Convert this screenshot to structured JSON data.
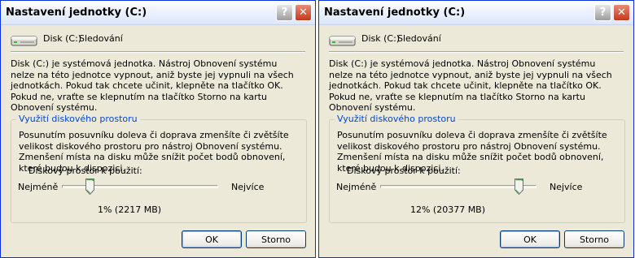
{
  "dialogs": [
    {
      "title": "Nastavení jednotky (C:)",
      "help_glyph": "?",
      "close_glyph": "✕",
      "disk_label": "Disk (C:)",
      "disk_status": "Sledování",
      "description": "Disk (C:) je systémová jednotka. Nástroj Obnovení systému nelze na této jednotce vypnout, aniž byste jej vypnuli na všech jednotkách. Pokud tak chcete učinit, klepněte na tlačítko OK. Pokud ne, vraťte se klepnutím na tlačítko Storno na kartu Obnovení systému.",
      "group_title": "Využití diskového prostoru",
      "group_description": "Posunutím posuvníku doleva či doprava zmenšíte či zvětšíte velikost diskového prostoru pro nástroj Obnovení systému.  Zmenšení místa na disku může snížit počet bodů obnovení, které budou k dispozici.",
      "usage_label": "Diskový prostor k použití:",
      "min_label": "Nejméně",
      "max_label": "Nejvíce",
      "slider_percent": 1,
      "value_text": "1% (2217 MB)",
      "ok_label": "OK",
      "cancel_label": "Storno"
    },
    {
      "title": "Nastavení jednotky (C:)",
      "help_glyph": "?",
      "close_glyph": "✕",
      "disk_label": "Disk (C:)",
      "disk_status": "Sledování",
      "description": "Disk (C:) je systémová jednotka. Nástroj Obnovení systému nelze na této jednotce vypnout, aniž byste jej vypnuli na všech jednotkách. Pokud tak chcete učinit, klepněte na tlačítko OK. Pokud ne, vraťte se klepnutím na tlačítko Storno na kartu Obnovení systému.",
      "group_title": "Využití diskového prostoru",
      "group_description": "Posunutím posuvníku doleva či doprava zmenšíte či zvětšíte velikost diskového prostoru pro nástroj Obnovení systému.  Zmenšení místa na disku může snížit počet bodů obnovení, které budou k dispozici.",
      "usage_label": "Diskový prostor k použití:",
      "min_label": "Nejméně",
      "max_label": "Nejvíce",
      "slider_percent": 12,
      "value_text": "12% (20377 MB)",
      "ok_label": "OK",
      "cancel_label": "Storno"
    }
  ],
  "colors": {
    "title_text": "#000000",
    "group_title": "#0046d5",
    "close_button": "#c4391c",
    "window_face": "#ece9d8"
  }
}
